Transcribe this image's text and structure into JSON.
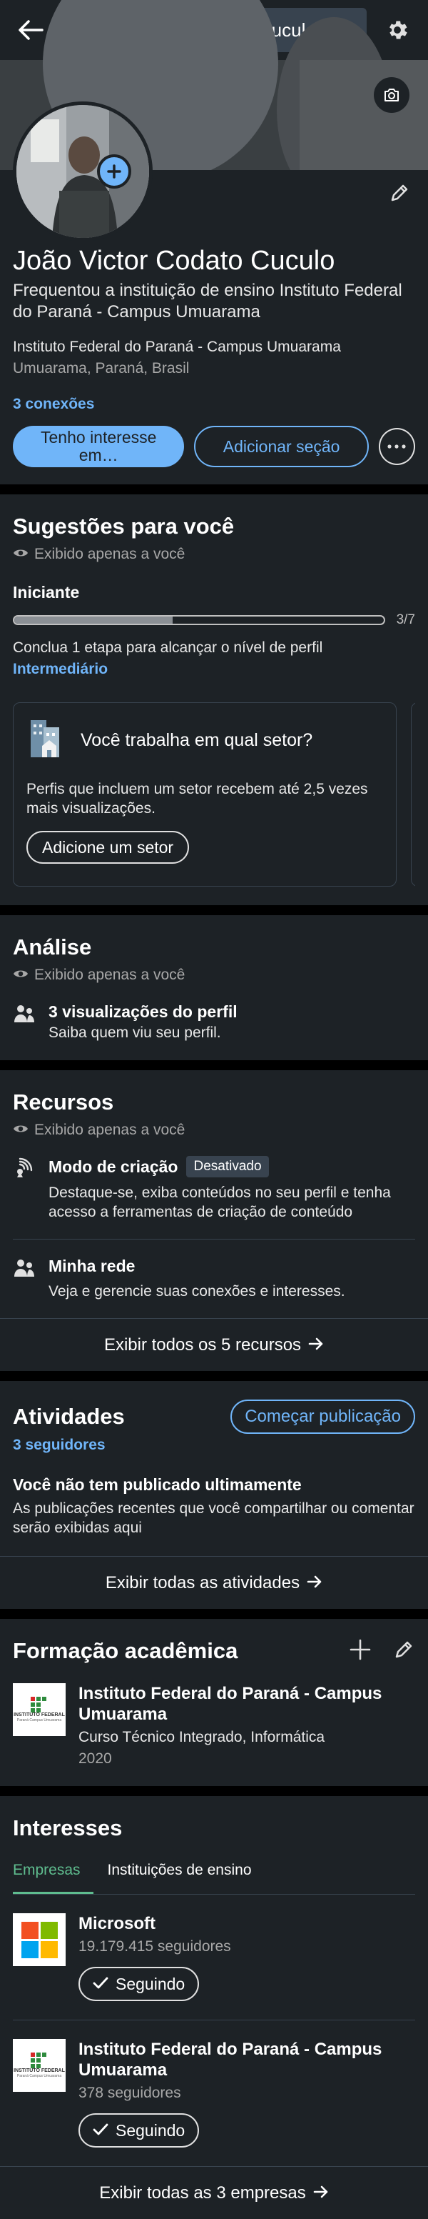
{
  "search": {
    "value": "João Victor Codato Cuculo"
  },
  "profile": {
    "name": "João Victor Codato Cuculo",
    "headline": "Frequentou a instituição de ensino Instituto Federal do Paraná - Campus Umuarama",
    "education": "Instituto Federal do Paraná - Campus Umuarama",
    "location": "Umuarama, Paraná, Brasil",
    "connections": "3 conexões",
    "btn_open_to": "Tenho interesse em…",
    "btn_add_section": "Adicionar seção"
  },
  "suggestions": {
    "title": "Sugestões para você",
    "private": "Exibido apenas a você",
    "level": "Iniciante",
    "progress": {
      "current": 3,
      "total": 7,
      "label": "3/7"
    },
    "step_text": "Conclua 1 etapa para alcançar o nível de perfil",
    "step_link": "Intermediário",
    "card": {
      "title": "Você trabalha em qual setor?",
      "body": "Perfis que incluem um setor recebem até 2,5 vezes mais visualizações.",
      "button": "Adicione um setor"
    }
  },
  "analytics": {
    "title": "Análise",
    "private": "Exibido apenas a você",
    "views_title": "3 visualizações do perfil",
    "views_sub": "Saiba quem viu seu perfil."
  },
  "resources": {
    "title": "Recursos",
    "private": "Exibido apenas a você",
    "items": [
      {
        "title": "Modo de criação",
        "badge": "Desativado",
        "sub": "Destaque-se, exiba conteúdos no seu perfil e tenha acesso a ferramentas de criação de conteúdo"
      },
      {
        "title": "Minha rede",
        "badge": "",
        "sub": "Veja e gerencie suas conexões e interesses."
      }
    ],
    "footer": "Exibir todos os 5 recursos"
  },
  "activity": {
    "title": "Atividades",
    "followers": "3 seguidores",
    "publish_btn": "Começar publicação",
    "empty_title": "Você não tem publicado ultimamente",
    "empty_sub": "As publicações recentes que você compartilhar ou comentar serão exibidas aqui",
    "footer": "Exibir todas as atividades"
  },
  "education": {
    "title": "Formação acadêmica",
    "items": [
      {
        "school": "Instituto Federal do Paraná - Campus Umuarama",
        "course": "Curso Técnico Integrado, Informática",
        "year": "2020"
      }
    ],
    "logo_text": "INSTITUTO FEDERAL",
    "logo_sub": "Paraná Campus Umuarama"
  },
  "interests": {
    "title": "Interesses",
    "tabs": [
      "Empresas",
      "Instituições de ensino"
    ],
    "items": [
      {
        "name": "Microsoft",
        "followers": "19.179.415 seguidores",
        "button": "Seguindo"
      },
      {
        "name": "Instituto Federal do Paraná - Campus Umuarama",
        "followers": "378 seguidores",
        "button": "Seguindo"
      }
    ],
    "footer": "Exibir todas as 3 empresas"
  },
  "colors": {
    "background": "#1d2226",
    "accent": "#70b5f9",
    "tab_active": "#5fbd8f"
  }
}
